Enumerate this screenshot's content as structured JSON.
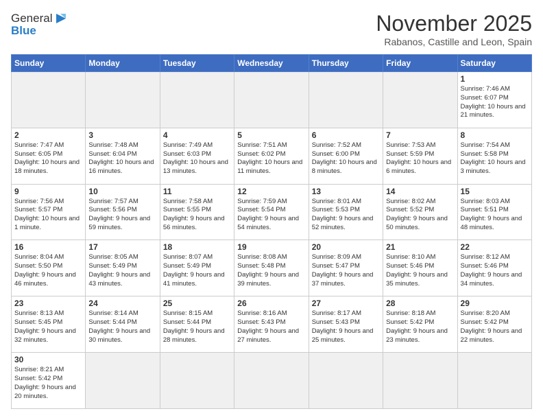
{
  "header": {
    "logo_general": "General",
    "logo_blue": "Blue",
    "month_title": "November 2025",
    "location": "Rabanos, Castille and Leon, Spain"
  },
  "days_of_week": [
    "Sunday",
    "Monday",
    "Tuesday",
    "Wednesday",
    "Thursday",
    "Friday",
    "Saturday"
  ],
  "weeks": [
    [
      {
        "day": "",
        "info": ""
      },
      {
        "day": "",
        "info": ""
      },
      {
        "day": "",
        "info": ""
      },
      {
        "day": "",
        "info": ""
      },
      {
        "day": "",
        "info": ""
      },
      {
        "day": "",
        "info": ""
      },
      {
        "day": "1",
        "info": "Sunrise: 7:46 AM\nSunset: 6:07 PM\nDaylight: 10 hours\nand 21 minutes."
      }
    ],
    [
      {
        "day": "2",
        "info": "Sunrise: 7:47 AM\nSunset: 6:05 PM\nDaylight: 10 hours\nand 18 minutes."
      },
      {
        "day": "3",
        "info": "Sunrise: 7:48 AM\nSunset: 6:04 PM\nDaylight: 10 hours\nand 16 minutes."
      },
      {
        "day": "4",
        "info": "Sunrise: 7:49 AM\nSunset: 6:03 PM\nDaylight: 10 hours\nand 13 minutes."
      },
      {
        "day": "5",
        "info": "Sunrise: 7:51 AM\nSunset: 6:02 PM\nDaylight: 10 hours\nand 11 minutes."
      },
      {
        "day": "6",
        "info": "Sunrise: 7:52 AM\nSunset: 6:00 PM\nDaylight: 10 hours\nand 8 minutes."
      },
      {
        "day": "7",
        "info": "Sunrise: 7:53 AM\nSunset: 5:59 PM\nDaylight: 10 hours\nand 6 minutes."
      },
      {
        "day": "8",
        "info": "Sunrise: 7:54 AM\nSunset: 5:58 PM\nDaylight: 10 hours\nand 3 minutes."
      }
    ],
    [
      {
        "day": "9",
        "info": "Sunrise: 7:56 AM\nSunset: 5:57 PM\nDaylight: 10 hours\nand 1 minute."
      },
      {
        "day": "10",
        "info": "Sunrise: 7:57 AM\nSunset: 5:56 PM\nDaylight: 9 hours\nand 59 minutes."
      },
      {
        "day": "11",
        "info": "Sunrise: 7:58 AM\nSunset: 5:55 PM\nDaylight: 9 hours\nand 56 minutes."
      },
      {
        "day": "12",
        "info": "Sunrise: 7:59 AM\nSunset: 5:54 PM\nDaylight: 9 hours\nand 54 minutes."
      },
      {
        "day": "13",
        "info": "Sunrise: 8:01 AM\nSunset: 5:53 PM\nDaylight: 9 hours\nand 52 minutes."
      },
      {
        "day": "14",
        "info": "Sunrise: 8:02 AM\nSunset: 5:52 PM\nDaylight: 9 hours\nand 50 minutes."
      },
      {
        "day": "15",
        "info": "Sunrise: 8:03 AM\nSunset: 5:51 PM\nDaylight: 9 hours\nand 48 minutes."
      }
    ],
    [
      {
        "day": "16",
        "info": "Sunrise: 8:04 AM\nSunset: 5:50 PM\nDaylight: 9 hours\nand 46 minutes."
      },
      {
        "day": "17",
        "info": "Sunrise: 8:05 AM\nSunset: 5:49 PM\nDaylight: 9 hours\nand 43 minutes."
      },
      {
        "day": "18",
        "info": "Sunrise: 8:07 AM\nSunset: 5:49 PM\nDaylight: 9 hours\nand 41 minutes."
      },
      {
        "day": "19",
        "info": "Sunrise: 8:08 AM\nSunset: 5:48 PM\nDaylight: 9 hours\nand 39 minutes."
      },
      {
        "day": "20",
        "info": "Sunrise: 8:09 AM\nSunset: 5:47 PM\nDaylight: 9 hours\nand 37 minutes."
      },
      {
        "day": "21",
        "info": "Sunrise: 8:10 AM\nSunset: 5:46 PM\nDaylight: 9 hours\nand 35 minutes."
      },
      {
        "day": "22",
        "info": "Sunrise: 8:12 AM\nSunset: 5:46 PM\nDaylight: 9 hours\nand 34 minutes."
      }
    ],
    [
      {
        "day": "23",
        "info": "Sunrise: 8:13 AM\nSunset: 5:45 PM\nDaylight: 9 hours\nand 32 minutes."
      },
      {
        "day": "24",
        "info": "Sunrise: 8:14 AM\nSunset: 5:44 PM\nDaylight: 9 hours\nand 30 minutes."
      },
      {
        "day": "25",
        "info": "Sunrise: 8:15 AM\nSunset: 5:44 PM\nDaylight: 9 hours\nand 28 minutes."
      },
      {
        "day": "26",
        "info": "Sunrise: 8:16 AM\nSunset: 5:43 PM\nDaylight: 9 hours\nand 27 minutes."
      },
      {
        "day": "27",
        "info": "Sunrise: 8:17 AM\nSunset: 5:43 PM\nDaylight: 9 hours\nand 25 minutes."
      },
      {
        "day": "28",
        "info": "Sunrise: 8:18 AM\nSunset: 5:42 PM\nDaylight: 9 hours\nand 23 minutes."
      },
      {
        "day": "29",
        "info": "Sunrise: 8:20 AM\nSunset: 5:42 PM\nDaylight: 9 hours\nand 22 minutes."
      }
    ],
    [
      {
        "day": "30",
        "info": "Sunrise: 8:21 AM\nSunset: 5:42 PM\nDaylight: 9 hours\nand 20 minutes."
      },
      {
        "day": "",
        "info": ""
      },
      {
        "day": "",
        "info": ""
      },
      {
        "day": "",
        "info": ""
      },
      {
        "day": "",
        "info": ""
      },
      {
        "day": "",
        "info": ""
      },
      {
        "day": "",
        "info": ""
      }
    ]
  ]
}
